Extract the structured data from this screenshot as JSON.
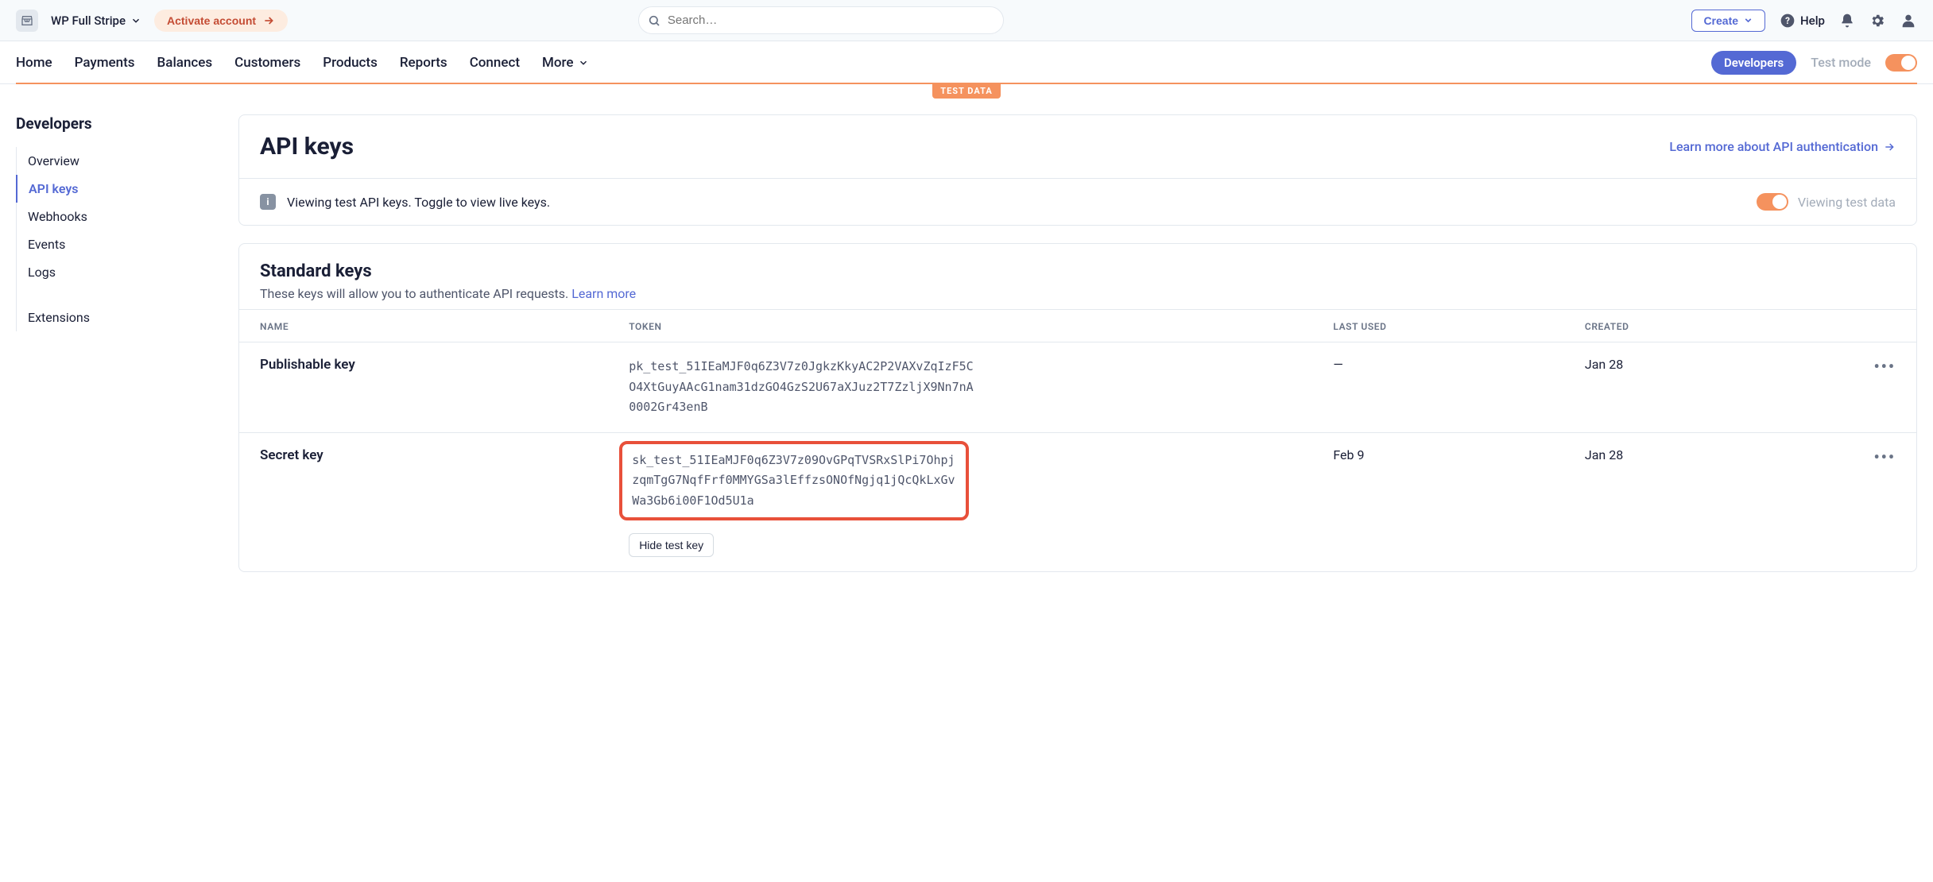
{
  "topbar": {
    "account_name": "WP Full Stripe",
    "activate_label": "Activate account",
    "search_placeholder": "Search…",
    "create_label": "Create",
    "help_label": "Help"
  },
  "nav": {
    "items": [
      "Home",
      "Payments",
      "Balances",
      "Customers",
      "Products",
      "Reports",
      "Connect",
      "More"
    ],
    "developers_label": "Developers",
    "testmode_label": "Test mode",
    "test_badge": "TEST DATA"
  },
  "sidebar": {
    "title": "Developers",
    "items": [
      "Overview",
      "API keys",
      "Webhooks",
      "Events",
      "Logs"
    ],
    "extensions_label": "Extensions",
    "active_index": 1
  },
  "page": {
    "title": "API keys",
    "learn_more": "Learn more about API authentication",
    "notice": "Viewing test API keys. Toggle to view live keys.",
    "viewing_test_label": "Viewing test data"
  },
  "standard_keys": {
    "title": "Standard keys",
    "subtitle_prefix": "These keys will allow you to authenticate API requests. ",
    "subtitle_link": "Learn more",
    "columns": {
      "name": "NAME",
      "token": "TOKEN",
      "last_used": "LAST USED",
      "created": "CREATED"
    },
    "rows": [
      {
        "name": "Publishable key",
        "token": "pk_test_51IEaMJF0q6Z3V7z0JgkzKkyAC2P2VAXvZqIzF5CO4XtGuyAAcG1nam31dzGO4GzS2U67aXJuz2T7ZzljX9Nn7nA0002Gr43enB",
        "last_used": "—",
        "created": "Jan 28",
        "highlight": false,
        "hide_label": ""
      },
      {
        "name": "Secret key",
        "token": "sk_test_51IEaMJF0q6Z3V7z09OvGPqTVSRxSlPi7OhpjzqmTgG7NqfFrf0MMYGSa3lEffzsONOfNgjq1jQcQkLxGvWa3Gb6i00F1Od5U1a",
        "last_used": "Feb 9",
        "created": "Jan 28",
        "highlight": true,
        "hide_label": "Hide test key"
      }
    ]
  }
}
